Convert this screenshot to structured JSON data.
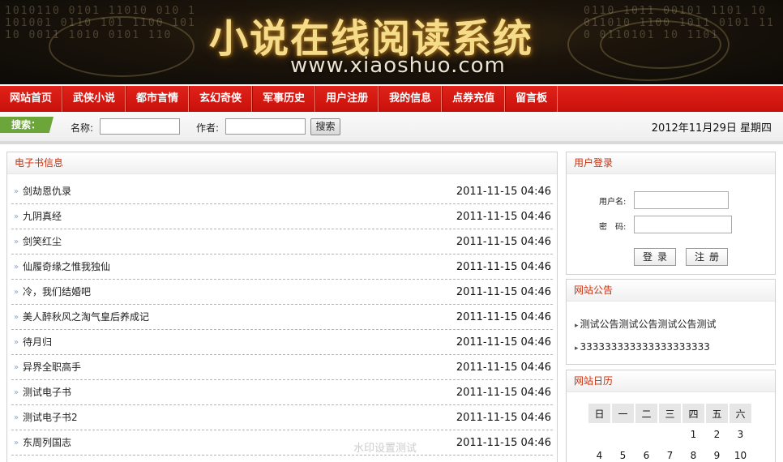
{
  "banner": {
    "title": "小说在线阅读系统",
    "url": "www.xiaoshuo.com",
    "digits_left": "1010110 0101 11010 010 1101001 0110 101 1100 10110 0011 1010 0101 110",
    "digits_right": "0110 1011 00101 1101 10 011010 1100 1011 0101 110 0110101 10 1101"
  },
  "nav": {
    "items": [
      "网站首页",
      "武侠小说",
      "都市言情",
      "玄幻奇侠",
      "军事历史",
      "用户注册",
      "我的信息",
      "点券充值",
      "留言板"
    ]
  },
  "search": {
    "tag": "搜索：",
    "name_label": "名称:",
    "name_value": "",
    "author_label": "作者:",
    "author_value": "",
    "button": "搜索",
    "date": "2012年11月29日 星期四"
  },
  "ebooks": {
    "title": "电子书信息",
    "items": [
      {
        "name": "剑劫恩仇录",
        "time": "2011-11-15 04:46"
      },
      {
        "name": "九阴真经",
        "time": "2011-11-15 04:46"
      },
      {
        "name": "剑笑红尘",
        "time": "2011-11-15 04:46"
      },
      {
        "name": "仙履奇缘之惟我独仙",
        "time": "2011-11-15 04:46"
      },
      {
        "name": "冷，我们结婚吧",
        "time": "2011-11-15 04:46"
      },
      {
        "name": "美人醉秋风之淘气皇后养成记",
        "time": "2011-11-15 04:46"
      },
      {
        "name": "待月归",
        "time": "2011-11-15 04:46"
      },
      {
        "name": "异界全职高手",
        "time": "2011-11-15 04:46"
      },
      {
        "name": "测试电子书",
        "time": "2011-11-15 04:46"
      },
      {
        "name": "测试电子书2",
        "time": "2011-11-15 04:46"
      },
      {
        "name": "东周列国志",
        "time": "2011-11-15 04:46"
      }
    ]
  },
  "login": {
    "title": "用户登录",
    "username_label": "用户名:",
    "password_label": "密　码:",
    "login_button": "登录",
    "register_button": "注册"
  },
  "notices": {
    "title": "网站公告",
    "items": [
      "测试公告测试公告测试公告测试",
      "333333333333333333333"
    ]
  },
  "calendar": {
    "title": "网站日历",
    "weekdays": [
      "日",
      "一",
      "二",
      "三",
      "四",
      "五",
      "六"
    ],
    "row1": [
      "",
      "",
      "",
      "",
      "1",
      "2",
      "3"
    ],
    "row2": [
      "4",
      "5",
      "6",
      "7",
      "8",
      "9",
      "10"
    ]
  },
  "watermark": "水印设置测试"
}
